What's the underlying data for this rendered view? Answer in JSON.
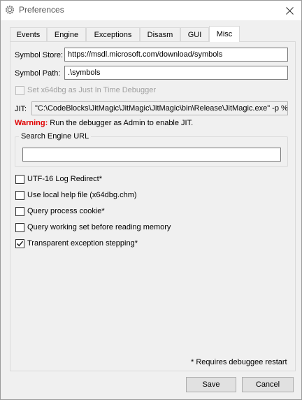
{
  "window": {
    "title": "Preferences",
    "icon": "gear-icon"
  },
  "tabs": [
    {
      "label": "Events"
    },
    {
      "label": "Engine"
    },
    {
      "label": "Exceptions"
    },
    {
      "label": "Disasm"
    },
    {
      "label": "GUI"
    },
    {
      "label": "Misc",
      "active": true
    }
  ],
  "misc": {
    "symbol_store_label": "Symbol Store:",
    "symbol_store_value": "https://msdl.microsoft.com/download/symbols",
    "symbol_path_label": "Symbol Path:",
    "symbol_path_value": ".\\symbols",
    "jit_checkbox_label": "Set x64dbg as Just In Time Debugger",
    "jit_label": "JIT:",
    "jit_value": "\"C:\\CodeBlocks\\JitMagic\\JitMagic\\JitMagic\\bin\\Release\\JitMagic.exe\" -p %ld",
    "warning_word": "Warning:",
    "warning_text": " Run the debugger as Admin to enable JIT.",
    "search_engine_label": "Search Engine URL",
    "search_engine_value": "",
    "options": [
      {
        "label": "UTF-16 Log Redirect*",
        "checked": false
      },
      {
        "label": "Use local help file (x64dbg.chm)",
        "checked": false
      },
      {
        "label": "Query process cookie*",
        "checked": false
      },
      {
        "label": "Query working set before reading memory",
        "checked": false
      },
      {
        "label": "Transparent exception stepping*",
        "checked": true
      }
    ],
    "restart_note": "* Requires debuggee restart"
  },
  "buttons": {
    "save": "Save",
    "cancel": "Cancel"
  },
  "colors": {
    "warning": "#e00000",
    "window_bg": "#f0f0f0"
  }
}
